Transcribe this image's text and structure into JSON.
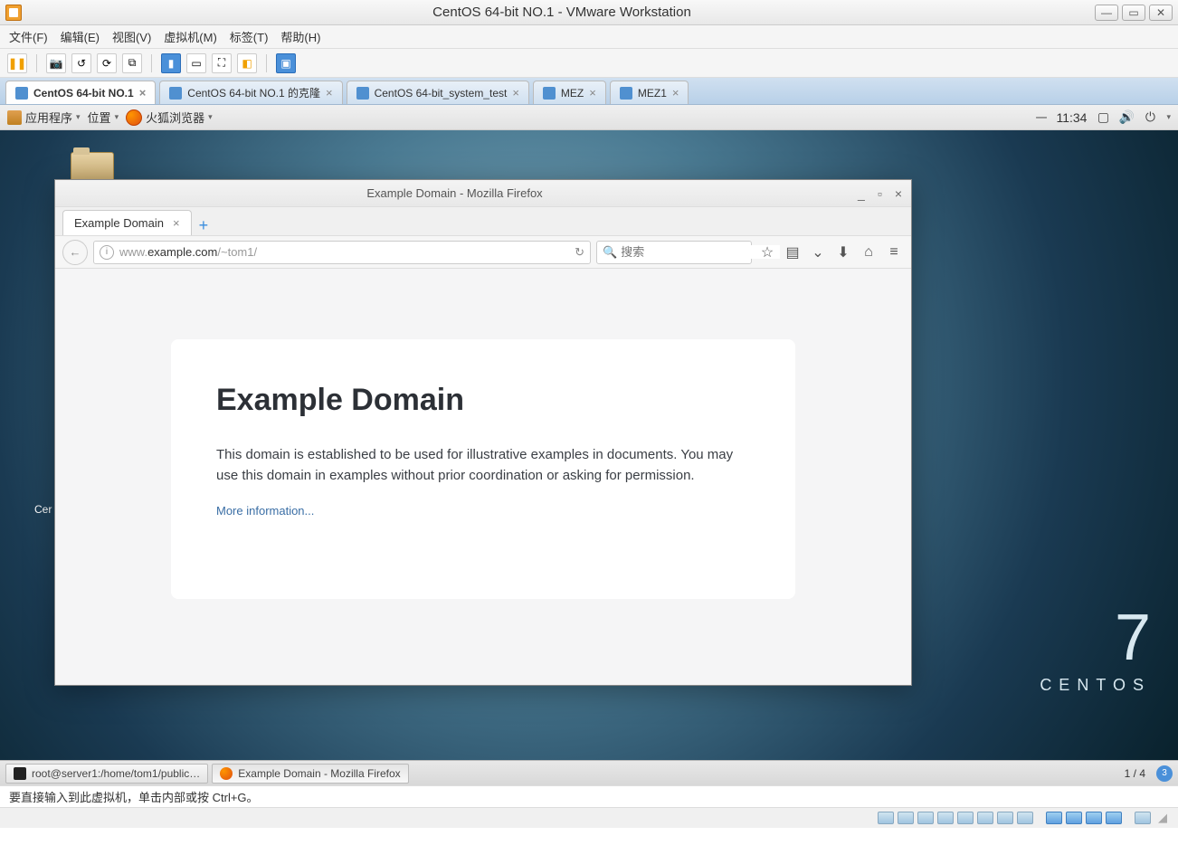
{
  "vmware": {
    "title": "CentOS 64-bit NO.1 - VMware Workstation",
    "menu": [
      "文件(F)",
      "编辑(E)",
      "视图(V)",
      "虚拟机(M)",
      "标签(T)",
      "帮助(H)"
    ],
    "tabs": [
      {
        "label": "CentOS 64-bit NO.1",
        "active": true
      },
      {
        "label": "CentOS 64-bit NO.1 的克隆",
        "active": false
      },
      {
        "label": "CentOS 64-bit_system_test",
        "active": false
      },
      {
        "label": "MEZ",
        "active": false
      },
      {
        "label": "MEZ1",
        "active": false
      }
    ],
    "hint": "要直接输入到此虚拟机，单击内部或按 Ctrl+G。"
  },
  "gnome": {
    "apps_label": "应用程序",
    "places_label": "位置",
    "ff_launcher": "火狐浏览器",
    "clock": "11:34",
    "clock_prefix": "一",
    "desk_label_short": "Cer",
    "brand_num": "7",
    "brand_word": "CENTOS",
    "taskbar": {
      "terminal": "root@server1:/home/tom1/public…",
      "firefox": "Example Domain - Mozilla Firefox",
      "pager": "1 / 4",
      "badge": "3"
    }
  },
  "firefox": {
    "win_title": "Example Domain - Mozilla Firefox",
    "tab_title": "Example Domain",
    "url_prefix": "www.",
    "url_host": "example.com",
    "url_path": "/~tom1/",
    "search_placeholder": "搜索",
    "page": {
      "heading": "Example Domain",
      "para": "This domain is established to be used for illustrative examples in documents. You may use this domain in examples without prior coordination or asking for permission.",
      "link": "More information..."
    }
  }
}
